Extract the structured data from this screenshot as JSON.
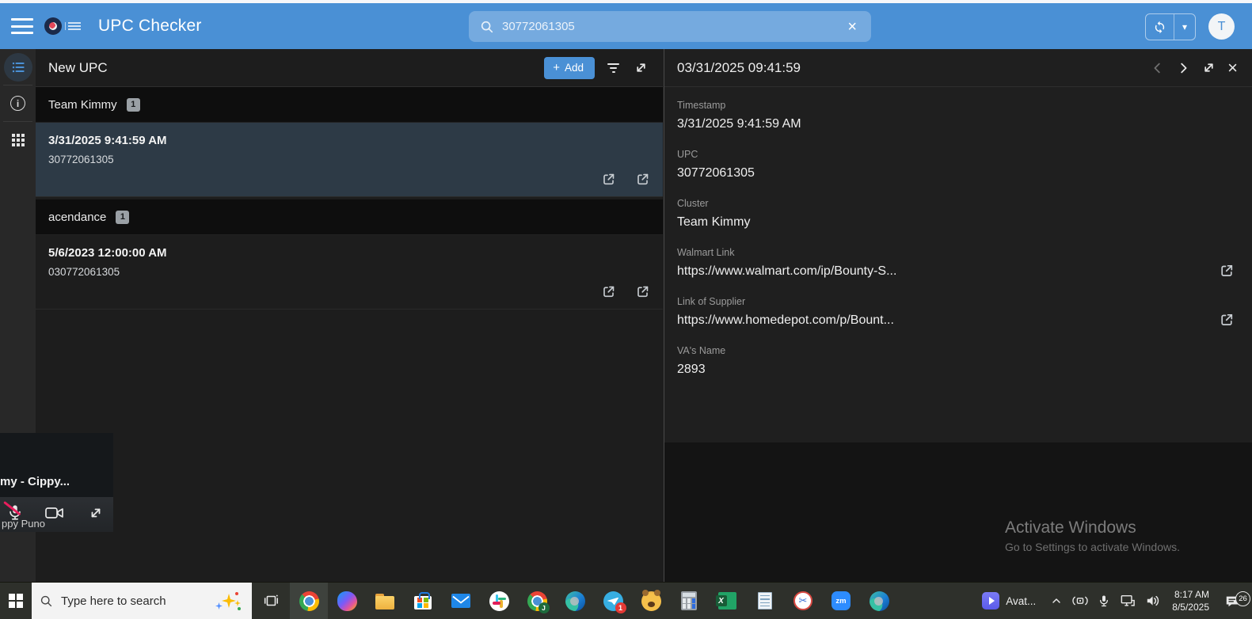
{
  "colors": {
    "header_blue": "#4a90d5",
    "accent_blue": "#4a90d5",
    "selected_item_bg": "#2d3a46",
    "panel_bg": "#1d1d1d",
    "group_header_bg": "#0e0e0e",
    "taskbar_bg": "#2e302b",
    "badge_gray": "#9aa0a5",
    "mic_muted_red": "#e91e5d",
    "notification_red": "#e53935"
  },
  "icons": {
    "close": "×",
    "caret": "▾",
    "plus": "+",
    "scissors": "✂"
  },
  "header": {
    "title": "UPC Checker",
    "search_value": "30772061305",
    "avatar_letter": "T"
  },
  "list_panel": {
    "title": "New UPC",
    "add_label": "Add",
    "groups": [
      {
        "name": "Team Kimmy",
        "count": "1",
        "items": [
          {
            "title": "3/31/2025 9:41:59 AM",
            "subtitle": "30772061305"
          }
        ]
      },
      {
        "name": "acendance",
        "count": "1",
        "items": [
          {
            "title": "5/6/2023 12:00:00 AM",
            "subtitle": "030772061305"
          }
        ]
      }
    ]
  },
  "detail_panel": {
    "title": "03/31/2025 09:41:59",
    "fields": [
      {
        "label": "Timestamp",
        "value": "3/31/2025 9:41:59 AM"
      },
      {
        "label": "UPC",
        "value": "30772061305"
      },
      {
        "label": "Cluster",
        "value": "Team Kimmy"
      },
      {
        "label": "Walmart Link",
        "value": "https://www.walmart.com/ip/Bounty-S..."
      },
      {
        "label": "Link of Supplier",
        "value": "https://www.homedepot.com/p/Bount..."
      },
      {
        "label": "VA's Name",
        "value": "2893"
      }
    ]
  },
  "watermark": {
    "line1": "Activate Windows",
    "line2": "Go to Settings to activate Windows."
  },
  "call_overlay": {
    "title": "my - Cippy...",
    "participant": "ppy Puno"
  },
  "taskbar": {
    "search_placeholder": "Type here to search",
    "apps": [
      "chrome",
      "copilot",
      "file-explorer",
      "microsoft-store",
      "mail",
      "slack",
      "chrome-profile",
      "edge",
      "telegram",
      "bear",
      "calculator",
      "excel",
      "notepad",
      "snipping-tool",
      "zoom",
      "edge-profile"
    ],
    "excel_letter": "X",
    "chrome_profile_letter": "J",
    "telegram_badge": "1",
    "zoom_label": "zm",
    "tray": {
      "media_label": "Avat...",
      "time": "8:17 AM",
      "date": "8/5/2025",
      "notification_count": "26"
    }
  }
}
